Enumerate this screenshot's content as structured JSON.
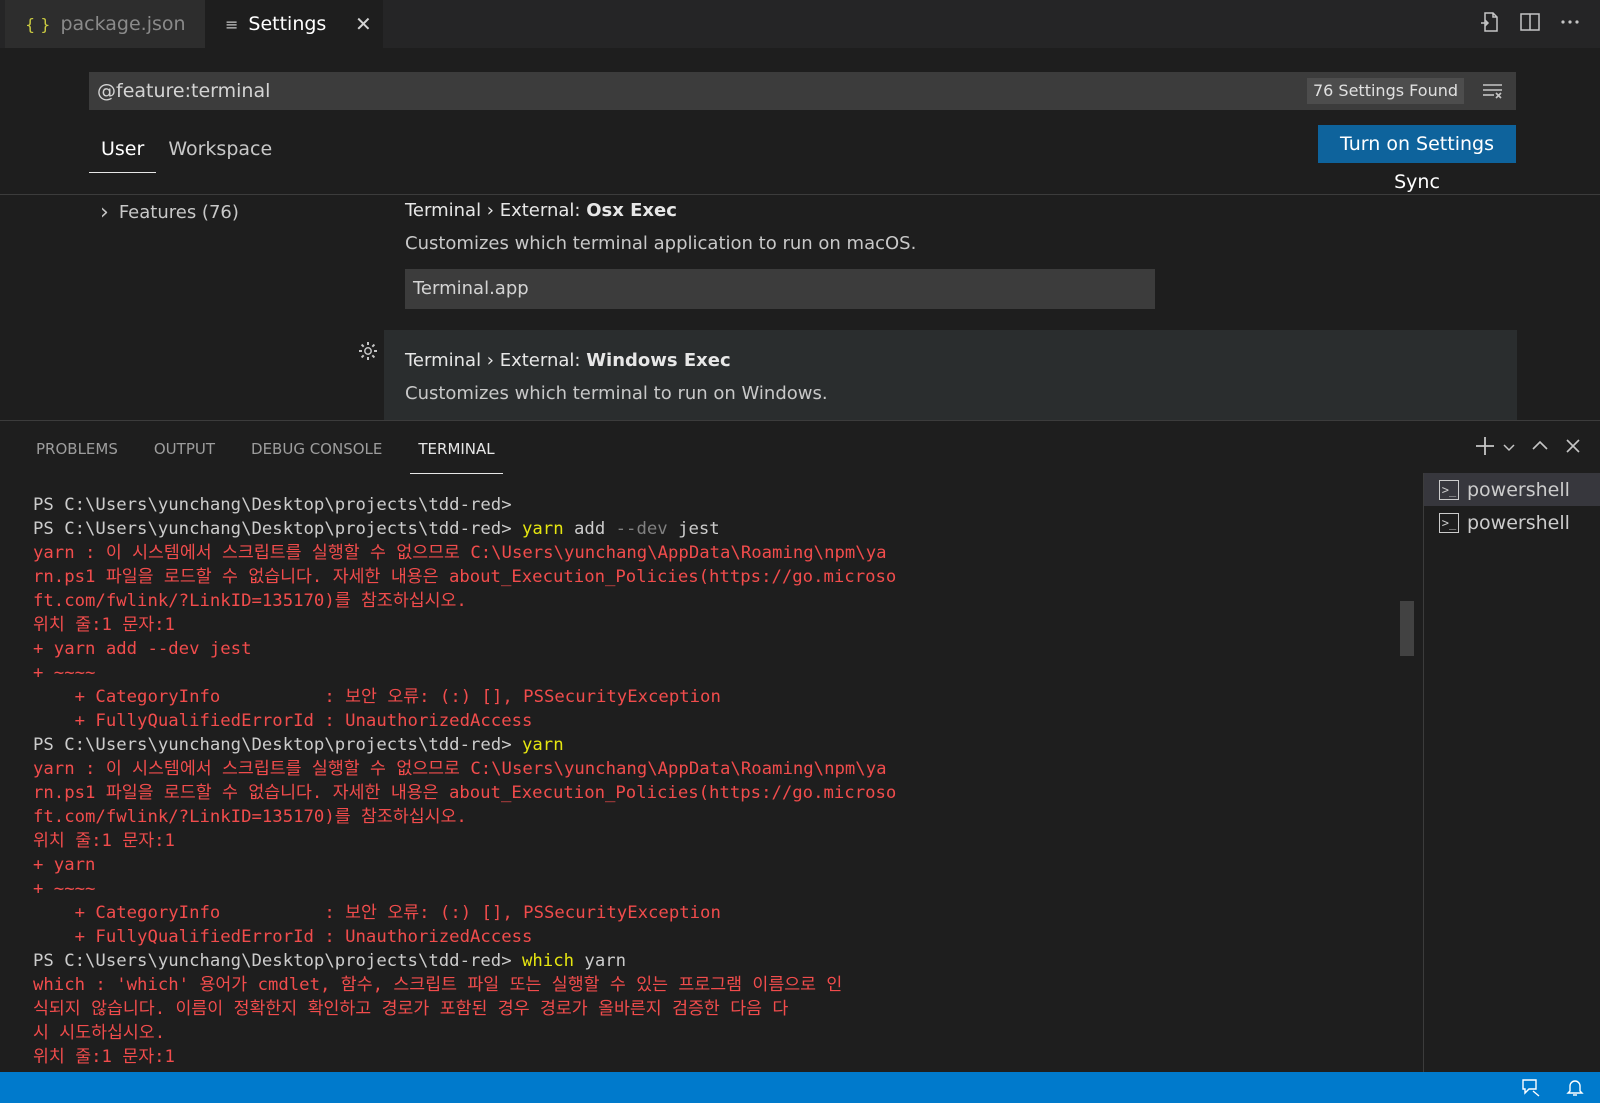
{
  "tabs": [
    {
      "icon": "braces-icon",
      "icon_glyph": "{ }",
      "label": "package.json",
      "active": false
    },
    {
      "icon": "settings-lines-icon",
      "icon_glyph": "≡",
      "label": "Settings",
      "active": true,
      "close": "✕"
    }
  ],
  "search": {
    "query": "@feature:terminal",
    "count": "76 Settings Found"
  },
  "scopes": [
    "User",
    "Workspace"
  ],
  "sync_button": "Turn on Settings Sync",
  "toc": {
    "chevron": "›",
    "label": "Features (76)"
  },
  "settings": [
    {
      "category": "Terminal › External: ",
      "name": "Osx Exec",
      "description": "Customizes which terminal application to run on macOS.",
      "value": "Terminal.app"
    },
    {
      "category": "Terminal › External: ",
      "name": "Windows Exec",
      "description": "Customizes which terminal to run on Windows."
    }
  ],
  "panel": {
    "tabs": [
      "PROBLEMS",
      "OUTPUT",
      "DEBUG CONSOLE",
      "TERMINAL"
    ],
    "active_tab": "TERMINAL"
  },
  "terminal": {
    "lines": [
      [
        {
          "c": "white",
          "t": "PS C:\\Users\\yunchang\\Desktop\\projects\\tdd-red>"
        }
      ],
      [
        {
          "c": "white",
          "t": "PS C:\\Users\\yunchang\\Desktop\\projects\\tdd-red> "
        },
        {
          "c": "cmd",
          "t": "yarn"
        },
        {
          "c": "arg",
          "t": " add "
        },
        {
          "c": "flag",
          "t": "--dev"
        },
        {
          "c": "arg",
          "t": " jest"
        }
      ],
      [
        {
          "c": "red",
          "t": "yarn : 이 시스템에서 스크립트를 실행할 수 없으므로 C:\\Users\\yunchang\\AppData\\Roaming\\npm\\ya"
        }
      ],
      [
        {
          "c": "red",
          "t": "rn.ps1 파일을 로드할 수 없습니다. 자세한 내용은 about_Execution_Policies(https://go.microso"
        }
      ],
      [
        {
          "c": "red",
          "t": "ft.com/fwlink/?LinkID=135170)를 참조하십시오."
        }
      ],
      [
        {
          "c": "red",
          "t": "위치 줄:1 문자:1"
        }
      ],
      [
        {
          "c": "red",
          "t": "+ yarn add --dev jest"
        }
      ],
      [
        {
          "c": "red",
          "t": "+ ~~~~"
        }
      ],
      [
        {
          "c": "red",
          "t": "    + CategoryInfo          : 보안 오류: (:) [], PSSecurityException"
        }
      ],
      [
        {
          "c": "red",
          "t": "    + FullyQualifiedErrorId : UnauthorizedAccess"
        }
      ],
      [
        {
          "c": "white",
          "t": "PS C:\\Users\\yunchang\\Desktop\\projects\\tdd-red> "
        },
        {
          "c": "cmd",
          "t": "yarn"
        }
      ],
      [
        {
          "c": "red",
          "t": "yarn : 이 시스템에서 스크립트를 실행할 수 없으므로 C:\\Users\\yunchang\\AppData\\Roaming\\npm\\ya"
        }
      ],
      [
        {
          "c": "red",
          "t": "rn.ps1 파일을 로드할 수 없습니다. 자세한 내용은 about_Execution_Policies(https://go.microso"
        }
      ],
      [
        {
          "c": "red",
          "t": "ft.com/fwlink/?LinkID=135170)를 참조하십시오."
        }
      ],
      [
        {
          "c": "red",
          "t": "위치 줄:1 문자:1"
        }
      ],
      [
        {
          "c": "red",
          "t": "+ yarn"
        }
      ],
      [
        {
          "c": "red",
          "t": "+ ~~~~"
        }
      ],
      [
        {
          "c": "red",
          "t": "    + CategoryInfo          : 보안 오류: (:) [], PSSecurityException"
        }
      ],
      [
        {
          "c": "red",
          "t": "    + FullyQualifiedErrorId : UnauthorizedAccess"
        }
      ],
      [
        {
          "c": "white",
          "t": "PS C:\\Users\\yunchang\\Desktop\\projects\\tdd-red> "
        },
        {
          "c": "cmd",
          "t": "which"
        },
        {
          "c": "arg",
          "t": " yarn"
        }
      ],
      [
        {
          "c": "red",
          "t": "which : 'which' 용어가 cmdlet, 함수, 스크립트 파일 또는 실행할 수 있는 프로그램 이름으로 인"
        }
      ],
      [
        {
          "c": "red",
          "t": "식되지 않습니다. 이름이 정확한지 확인하고 경로가 포함된 경우 경로가 올바른지 검증한 다음 다"
        }
      ],
      [
        {
          "c": "red",
          "t": "시 시도하십시오."
        }
      ],
      [
        {
          "c": "red",
          "t": "위치 줄:1 문자:1"
        }
      ]
    ],
    "instances": [
      {
        "label": "powershell",
        "selected": true
      },
      {
        "label": "powershell",
        "selected": false
      }
    ]
  },
  "colors": {
    "accent": "#007acc",
    "button": "#0e639c",
    "error_text": "#f14c4c",
    "command_text": "#e5e510"
  }
}
